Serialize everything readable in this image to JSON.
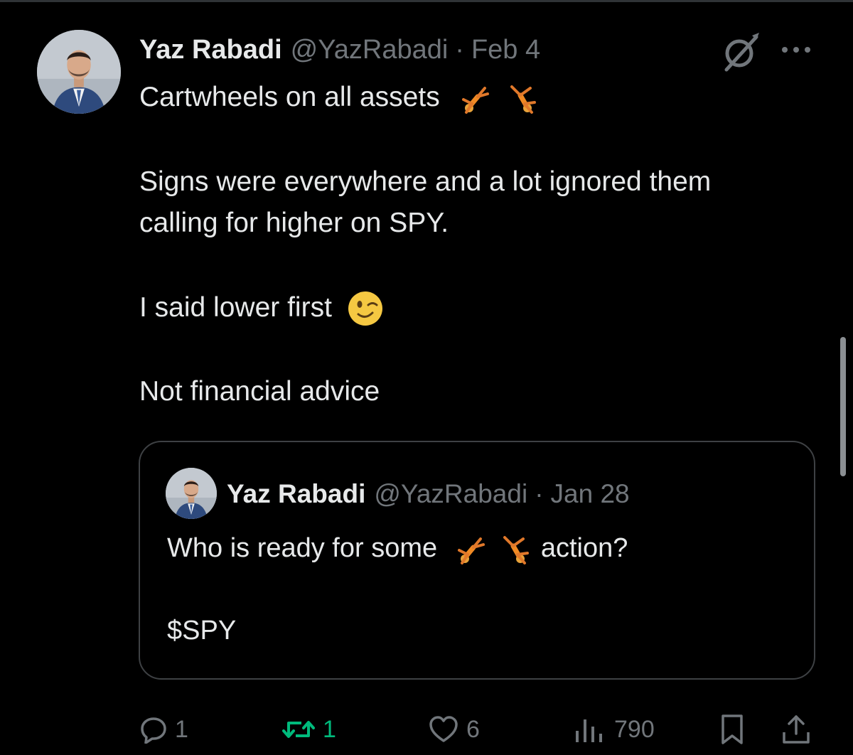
{
  "tweet": {
    "author": {
      "display_name": "Yaz Rabadi",
      "handle": "@YazRabadi"
    },
    "separator": "·",
    "date": "Feb 4",
    "text": {
      "line1": "Cartwheels on all assets",
      "line1_emoji": [
        "person-doing-cartwheel",
        "person-doing-cartwheel"
      ],
      "line2": "Signs were everywhere and a lot ignored them",
      "line3": "calling for higher on SPY.",
      "line4": "I said lower first",
      "line4_emoji": "winking-face",
      "line5": "Not financial advice"
    },
    "quoted": {
      "author": {
        "display_name": "Yaz Rabadi",
        "handle": "@YazRabadi"
      },
      "separator": "·",
      "date": "Jan 28",
      "text": {
        "line1_before": "Who is ready for some",
        "line1_emoji": [
          "person-doing-cartwheel",
          "person-doing-cartwheel"
        ],
        "line1_after": "action?",
        "line2": "$SPY"
      }
    },
    "actions": {
      "replies": "1",
      "reposts": "1",
      "likes": "6",
      "views": "790"
    },
    "icons": {
      "grok": "grok-icon",
      "more": "more-icon",
      "reply": "reply-icon",
      "repost": "repost-icon",
      "like": "heart-icon",
      "views": "views-icon",
      "bookmark": "bookmark-icon",
      "share": "share-icon"
    },
    "colors": {
      "background": "#000000",
      "text_primary": "#e7e9ea",
      "text_secondary": "#71767b",
      "repost_active": "#00ba7c",
      "border": "#3e4144"
    }
  }
}
